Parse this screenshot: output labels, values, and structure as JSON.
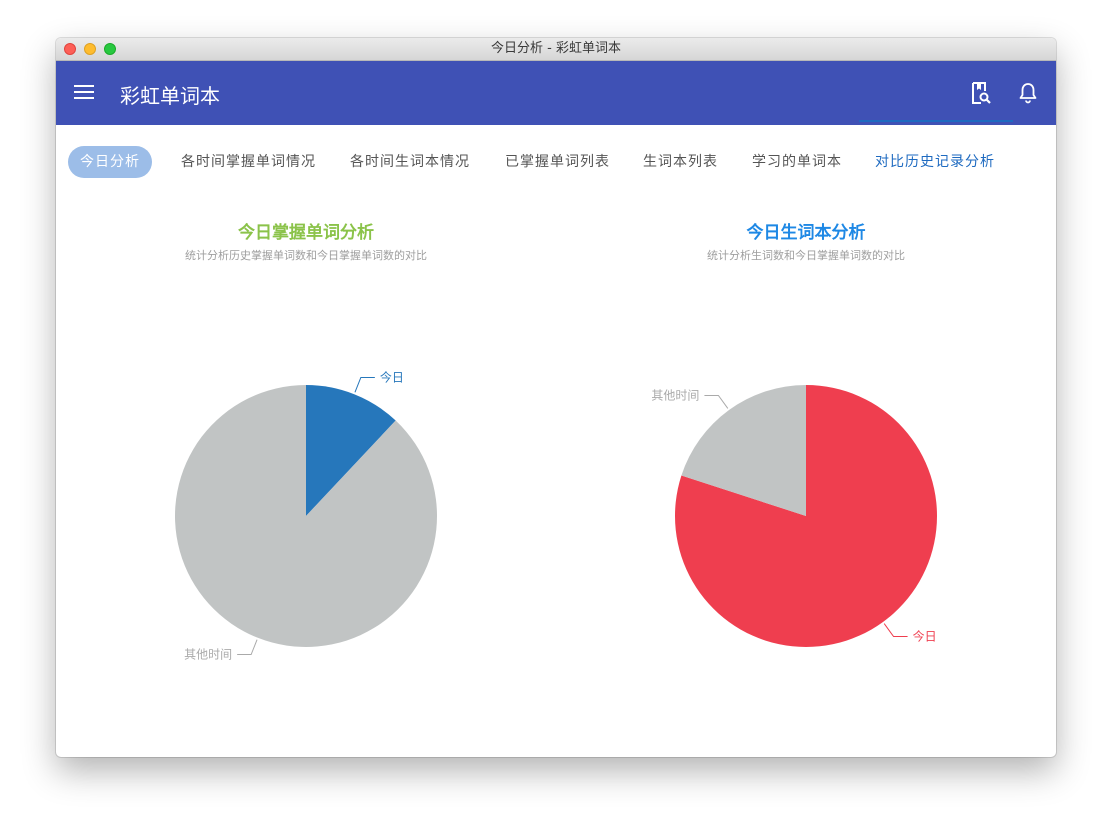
{
  "window": {
    "title": "今日分析 - 彩虹单词本"
  },
  "appbar": {
    "title": "彩虹单词本",
    "icons": [
      "menu-icon",
      "word-search-icon",
      "bell-icon"
    ]
  },
  "tabs": [
    {
      "label": "今日分析",
      "state": "selected"
    },
    {
      "label": "各时间掌握单词情况"
    },
    {
      "label": "各时间生词本情况"
    },
    {
      "label": "已掌握单词列表"
    },
    {
      "label": "生词本列表"
    },
    {
      "label": "学习的单词本"
    },
    {
      "label": "对比历史记录分析",
      "state": "active"
    }
  ],
  "colors": {
    "appbar": "#3f51b5",
    "pill": "#9cbde8",
    "green_title": "#8bc34a",
    "blue_title": "#1e88e5",
    "blue": "#2677bb",
    "red": "#ef3e4f",
    "grey": "#c1c4c4"
  },
  "chart_data": [
    {
      "type": "pie",
      "title": "今日掌握单词分析",
      "subtitle": "统计分析历史掌握单词数和今日掌握单词数的对比",
      "slices": [
        {
          "label": "今日",
          "value": 12,
          "color": "#2677bb"
        },
        {
          "label": "其他时间",
          "value": 88,
          "color": "#c1c4c4"
        }
      ]
    },
    {
      "type": "pie",
      "title": "今日生词本分析",
      "subtitle": "统计分析生词数和今日掌握单词数的对比",
      "slices": [
        {
          "label": "今日",
          "value": 80,
          "color": "#ef3e4f"
        },
        {
          "label": "其他时间",
          "value": 20,
          "color": "#c1c4c4"
        }
      ]
    }
  ]
}
